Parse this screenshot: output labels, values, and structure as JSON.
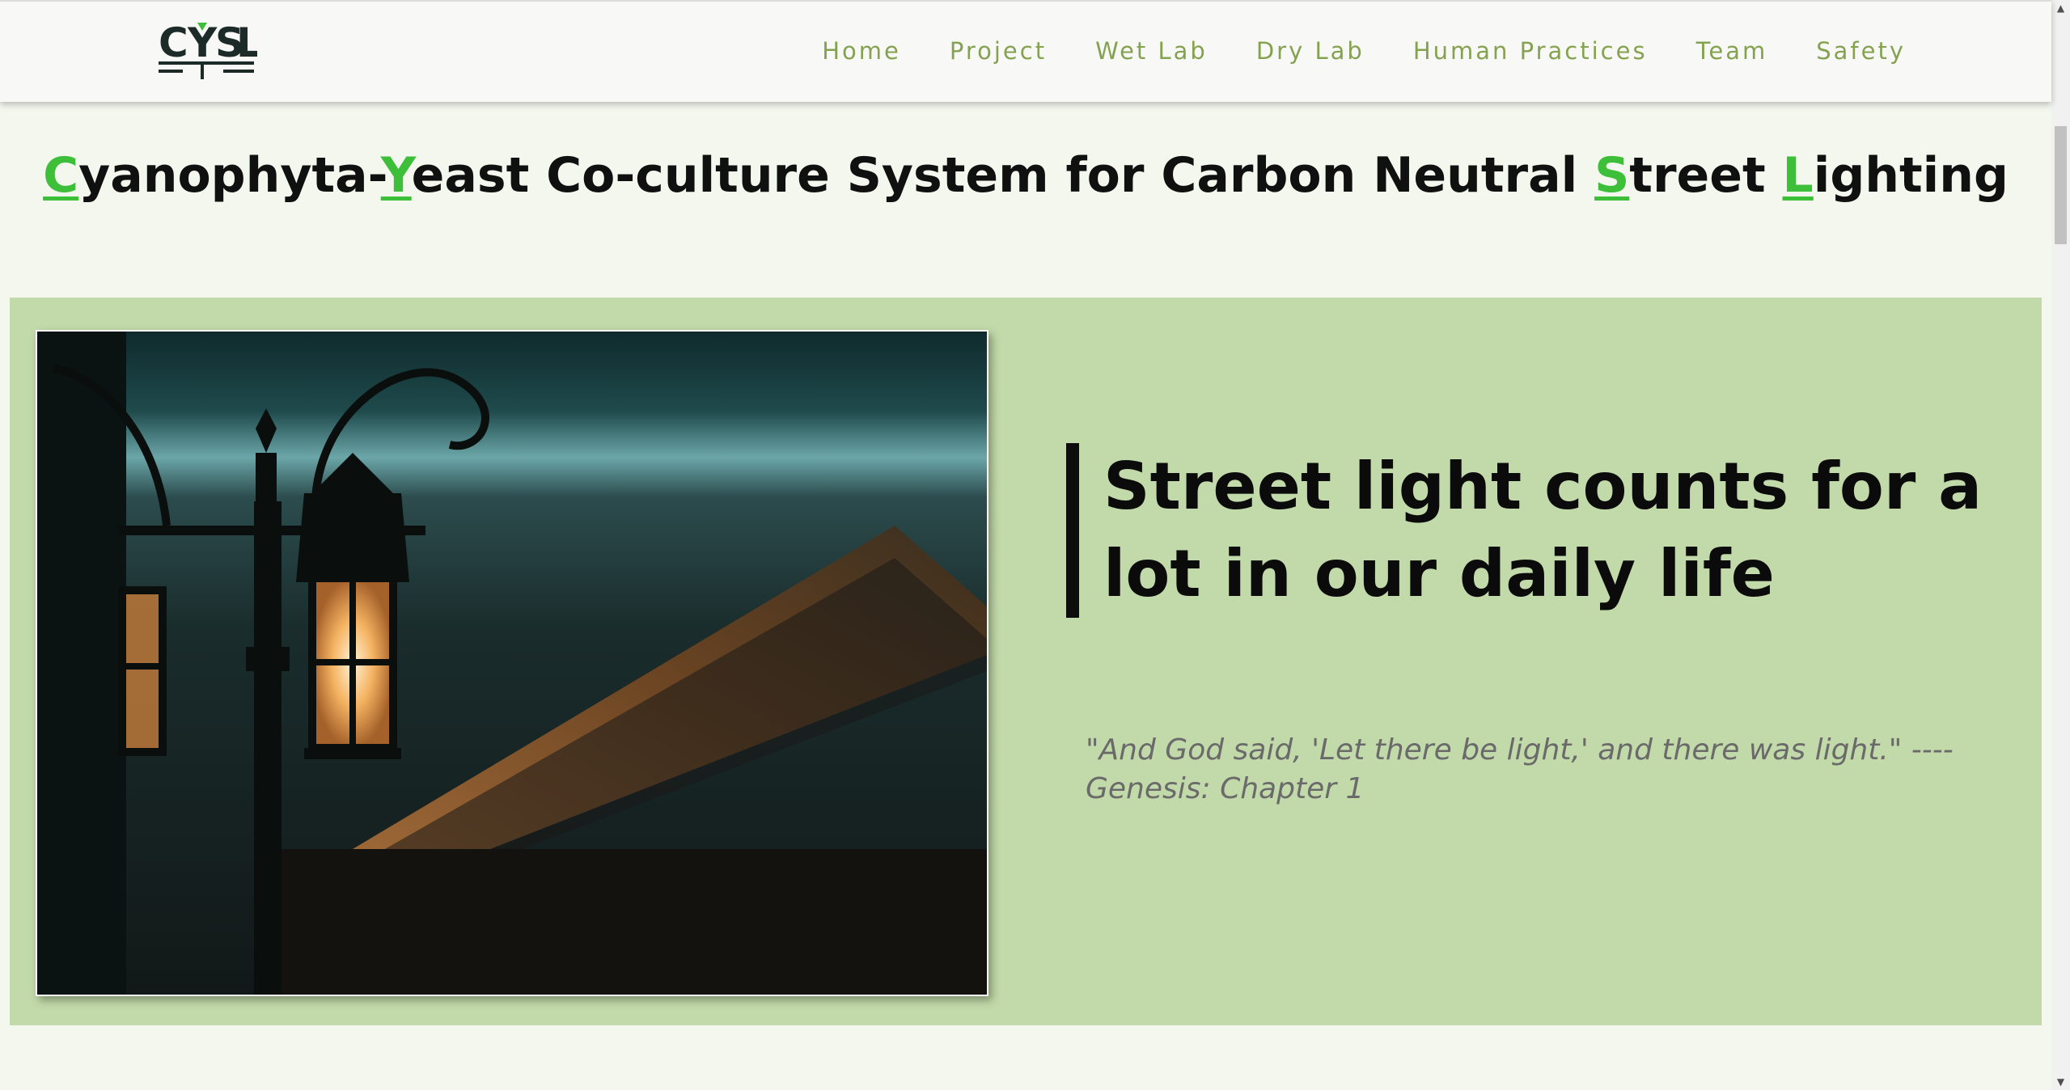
{
  "nav": {
    "logo_alt": "CYSL",
    "items": [
      {
        "label": "Home"
      },
      {
        "label": "Project"
      },
      {
        "label": "Wet Lab"
      },
      {
        "label": "Dry Lab"
      },
      {
        "label": "Human Practices"
      },
      {
        "label": "Team"
      },
      {
        "label": "Safety"
      }
    ]
  },
  "title": {
    "parts": [
      {
        "text": "C",
        "highlight": true
      },
      {
        "text": "yanophyta-",
        "highlight": false
      },
      {
        "text": "Y",
        "highlight": true
      },
      {
        "text": "east Co-culture System for Carbon Neutral ",
        "highlight": false
      },
      {
        "text": "S",
        "highlight": true
      },
      {
        "text": "treet ",
        "highlight": false
      },
      {
        "text": "L",
        "highlight": true
      },
      {
        "text": "ighting",
        "highlight": false
      }
    ]
  },
  "hero": {
    "headline": "Street light counts for a lot in our daily life",
    "quote": "\"And God said, 'Let there be light,' and there was light.\" ---- Genesis: Chapter 1"
  },
  "colors": {
    "accent_green": "#3ebf3a",
    "nav_text": "#84a24f",
    "hero_bg": "#c2daa9",
    "page_bg": "#f3f7ee"
  },
  "icons": {
    "logo": "cysl-logo",
    "photo": "street-lamp-photo",
    "scroll_up": "scroll-up-arrow-icon",
    "scroll_down": "scroll-down-arrow-icon"
  }
}
